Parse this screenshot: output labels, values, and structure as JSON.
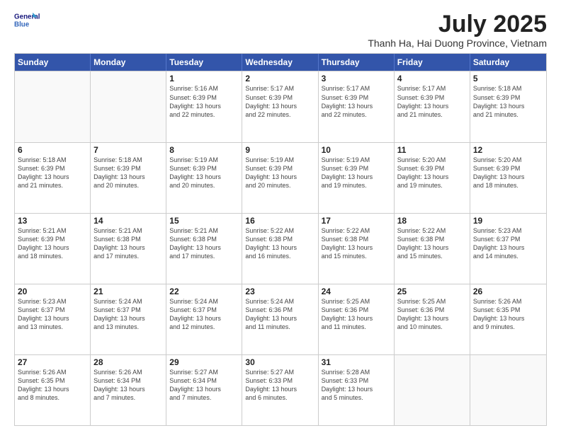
{
  "logo": {
    "line1": "General",
    "line2": "Blue"
  },
  "title": "July 2025",
  "subtitle": "Thanh Ha, Hai Duong Province, Vietnam",
  "days_of_week": [
    "Sunday",
    "Monday",
    "Tuesday",
    "Wednesday",
    "Thursday",
    "Friday",
    "Saturday"
  ],
  "weeks": [
    [
      {
        "day": "",
        "info": ""
      },
      {
        "day": "",
        "info": ""
      },
      {
        "day": "1",
        "info": "Sunrise: 5:16 AM\nSunset: 6:39 PM\nDaylight: 13 hours\nand 22 minutes."
      },
      {
        "day": "2",
        "info": "Sunrise: 5:17 AM\nSunset: 6:39 PM\nDaylight: 13 hours\nand 22 minutes."
      },
      {
        "day": "3",
        "info": "Sunrise: 5:17 AM\nSunset: 6:39 PM\nDaylight: 13 hours\nand 22 minutes."
      },
      {
        "day": "4",
        "info": "Sunrise: 5:17 AM\nSunset: 6:39 PM\nDaylight: 13 hours\nand 21 minutes."
      },
      {
        "day": "5",
        "info": "Sunrise: 5:18 AM\nSunset: 6:39 PM\nDaylight: 13 hours\nand 21 minutes."
      }
    ],
    [
      {
        "day": "6",
        "info": "Sunrise: 5:18 AM\nSunset: 6:39 PM\nDaylight: 13 hours\nand 21 minutes."
      },
      {
        "day": "7",
        "info": "Sunrise: 5:18 AM\nSunset: 6:39 PM\nDaylight: 13 hours\nand 20 minutes."
      },
      {
        "day": "8",
        "info": "Sunrise: 5:19 AM\nSunset: 6:39 PM\nDaylight: 13 hours\nand 20 minutes."
      },
      {
        "day": "9",
        "info": "Sunrise: 5:19 AM\nSunset: 6:39 PM\nDaylight: 13 hours\nand 20 minutes."
      },
      {
        "day": "10",
        "info": "Sunrise: 5:19 AM\nSunset: 6:39 PM\nDaylight: 13 hours\nand 19 minutes."
      },
      {
        "day": "11",
        "info": "Sunrise: 5:20 AM\nSunset: 6:39 PM\nDaylight: 13 hours\nand 19 minutes."
      },
      {
        "day": "12",
        "info": "Sunrise: 5:20 AM\nSunset: 6:39 PM\nDaylight: 13 hours\nand 18 minutes."
      }
    ],
    [
      {
        "day": "13",
        "info": "Sunrise: 5:21 AM\nSunset: 6:39 PM\nDaylight: 13 hours\nand 18 minutes."
      },
      {
        "day": "14",
        "info": "Sunrise: 5:21 AM\nSunset: 6:38 PM\nDaylight: 13 hours\nand 17 minutes."
      },
      {
        "day": "15",
        "info": "Sunrise: 5:21 AM\nSunset: 6:38 PM\nDaylight: 13 hours\nand 17 minutes."
      },
      {
        "day": "16",
        "info": "Sunrise: 5:22 AM\nSunset: 6:38 PM\nDaylight: 13 hours\nand 16 minutes."
      },
      {
        "day": "17",
        "info": "Sunrise: 5:22 AM\nSunset: 6:38 PM\nDaylight: 13 hours\nand 15 minutes."
      },
      {
        "day": "18",
        "info": "Sunrise: 5:22 AM\nSunset: 6:38 PM\nDaylight: 13 hours\nand 15 minutes."
      },
      {
        "day": "19",
        "info": "Sunrise: 5:23 AM\nSunset: 6:37 PM\nDaylight: 13 hours\nand 14 minutes."
      }
    ],
    [
      {
        "day": "20",
        "info": "Sunrise: 5:23 AM\nSunset: 6:37 PM\nDaylight: 13 hours\nand 13 minutes."
      },
      {
        "day": "21",
        "info": "Sunrise: 5:24 AM\nSunset: 6:37 PM\nDaylight: 13 hours\nand 13 minutes."
      },
      {
        "day": "22",
        "info": "Sunrise: 5:24 AM\nSunset: 6:37 PM\nDaylight: 13 hours\nand 12 minutes."
      },
      {
        "day": "23",
        "info": "Sunrise: 5:24 AM\nSunset: 6:36 PM\nDaylight: 13 hours\nand 11 minutes."
      },
      {
        "day": "24",
        "info": "Sunrise: 5:25 AM\nSunset: 6:36 PM\nDaylight: 13 hours\nand 11 minutes."
      },
      {
        "day": "25",
        "info": "Sunrise: 5:25 AM\nSunset: 6:36 PM\nDaylight: 13 hours\nand 10 minutes."
      },
      {
        "day": "26",
        "info": "Sunrise: 5:26 AM\nSunset: 6:35 PM\nDaylight: 13 hours\nand 9 minutes."
      }
    ],
    [
      {
        "day": "27",
        "info": "Sunrise: 5:26 AM\nSunset: 6:35 PM\nDaylight: 13 hours\nand 8 minutes."
      },
      {
        "day": "28",
        "info": "Sunrise: 5:26 AM\nSunset: 6:34 PM\nDaylight: 13 hours\nand 7 minutes."
      },
      {
        "day": "29",
        "info": "Sunrise: 5:27 AM\nSunset: 6:34 PM\nDaylight: 13 hours\nand 7 minutes."
      },
      {
        "day": "30",
        "info": "Sunrise: 5:27 AM\nSunset: 6:33 PM\nDaylight: 13 hours\nand 6 minutes."
      },
      {
        "day": "31",
        "info": "Sunrise: 5:28 AM\nSunset: 6:33 PM\nDaylight: 13 hours\nand 5 minutes."
      },
      {
        "day": "",
        "info": ""
      },
      {
        "day": "",
        "info": ""
      }
    ]
  ]
}
